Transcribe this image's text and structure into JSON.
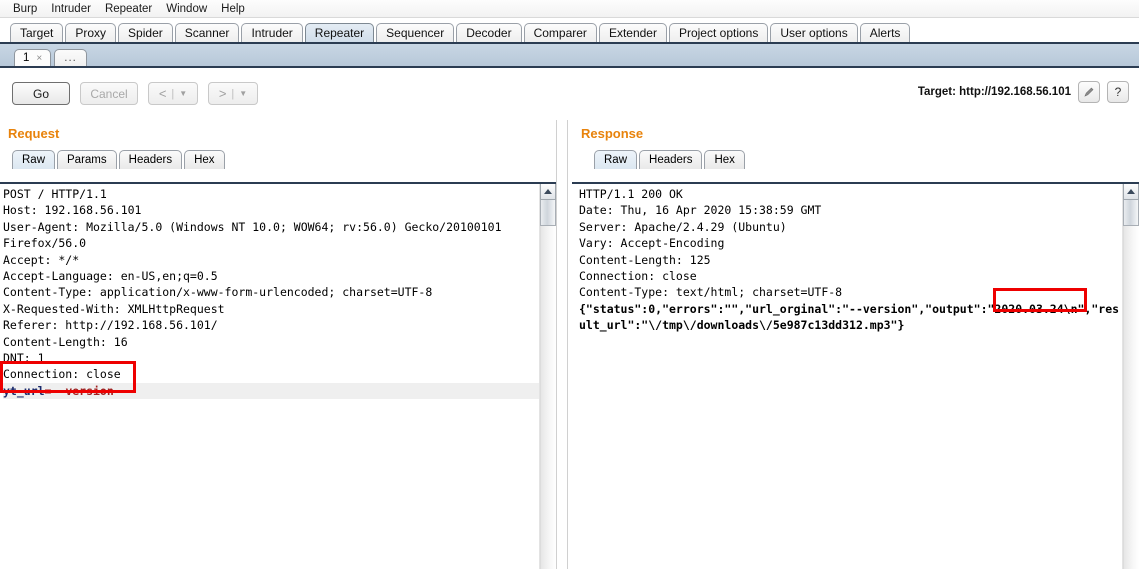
{
  "app": {
    "name": "Burp Suite",
    "menu": [
      "Burp",
      "Intruder",
      "Repeater",
      "Window",
      "Help"
    ]
  },
  "main_tabs": [
    {
      "label": "Target",
      "active": false
    },
    {
      "label": "Proxy",
      "active": false
    },
    {
      "label": "Spider",
      "active": false
    },
    {
      "label": "Scanner",
      "active": false
    },
    {
      "label": "Intruder",
      "active": false
    },
    {
      "label": "Repeater",
      "active": true
    },
    {
      "label": "Sequencer",
      "active": false
    },
    {
      "label": "Decoder",
      "active": false
    },
    {
      "label": "Comparer",
      "active": false
    },
    {
      "label": "Extender",
      "active": false
    },
    {
      "label": "Project options",
      "active": false
    },
    {
      "label": "User options",
      "active": false
    },
    {
      "label": "Alerts",
      "active": false
    }
  ],
  "sub_tabs": {
    "items": [
      {
        "label": "1",
        "close": "×",
        "active": true
      },
      {
        "label": "...",
        "close": "",
        "active": false
      }
    ]
  },
  "toolbar": {
    "go_label": "Go",
    "cancel_label": "Cancel",
    "back_arrow": "<",
    "back_sep": "|",
    "back_caret": "▼",
    "forward_arrow": ">",
    "forward_sep": "|",
    "forward_caret": "▼",
    "target_label": "Target: http://192.168.56.101",
    "edit_icon": "╱",
    "help_label": "?"
  },
  "request_panel": {
    "title": "Request",
    "tabs": [
      {
        "label": "Raw",
        "active": true
      },
      {
        "label": "Params",
        "active": false
      },
      {
        "label": "Headers",
        "active": false
      },
      {
        "label": "Hex",
        "active": false
      }
    ],
    "headers_text": "POST / HTTP/1.1\nHost: 192.168.56.101\nUser-Agent: Mozilla/5.0 (Windows NT 10.0; WOW64; rv:56.0) Gecko/20100101\nFirefox/56.0\nAccept: */*\nAccept-Language: en-US,en;q=0.5\nContent-Type: application/x-www-form-urlencoded; charset=UTF-8\nX-Requested-With: XMLHttpRequest\nReferer: http://192.168.56.101/\nContent-Length: 16\nDNT: 1\nConnection: close\n",
    "body_param_name": "yt_url",
    "body_param_assign": "=--version",
    "body_full": "yt_url=--version"
  },
  "response_panel": {
    "title": "Response",
    "tabs": [
      {
        "label": "Raw",
        "active": true
      },
      {
        "label": "Headers",
        "active": false
      },
      {
        "label": "Hex",
        "active": false
      }
    ],
    "headers_text": "HTTP/1.1 200 OK\nDate: Thu, 16 Apr 2020 15:38:59 GMT\nServer: Apache/2.4.29 (Ubuntu)\nVary: Accept-Encoding\nContent-Length: 125\nConnection: close\nContent-Type: text/html; charset=UTF-8\n",
    "body_before": "{\"status\":0,\"errors\":\"\",\"url_orginal\":\"--version\",\"output\":\"",
    "body_highlight": "2020.03.24\\n",
    "body_after": "\",\"result_url\":\"\\/tmp\\/downloads\\/5e987c13dd312.mp3\"}"
  },
  "annotations": {
    "request_box_target": "yt_url=--version",
    "response_box_target": "2020.03.24\\n",
    "box_color": "#ee0000"
  }
}
